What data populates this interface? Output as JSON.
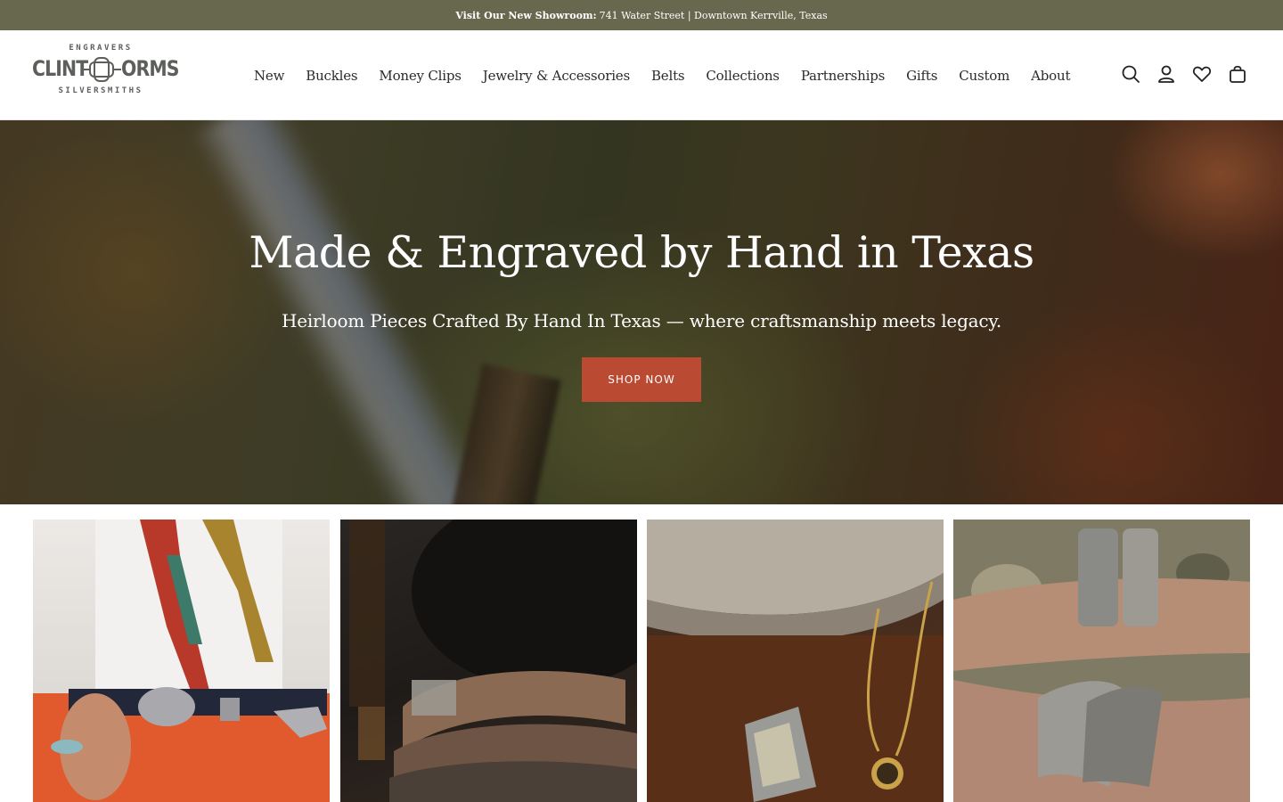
{
  "announcement": {
    "label": "Visit Our New Showroom:",
    "text": "741 Water Street | Downtown Kerrville, Texas"
  },
  "logo": {
    "top": "ENGRAVERS",
    "word_left": "CLINT",
    "word_right": "ORMS",
    "bottom": "SILVERSMITHS"
  },
  "nav": {
    "items": [
      "New",
      "Buckles",
      "Money Clips",
      "Jewelry & Accessories",
      "Belts",
      "Collections",
      "Partnerships",
      "Gifts",
      "Custom",
      "About"
    ]
  },
  "header_icons": [
    "search-icon",
    "account-icon",
    "wishlist-heart-icon",
    "cart-bag-icon"
  ],
  "hero": {
    "title": "Made & Engraved by Hand in Texas",
    "subtitle": "Heirloom Pieces Crafted By Hand In Texas — where craftsmanship meets legacy.",
    "cta": "SHOP NOW"
  },
  "colors": {
    "announcement_bg": "#68684e",
    "cta_bg": "#bb4a32",
    "text": "#2b2b2b"
  }
}
